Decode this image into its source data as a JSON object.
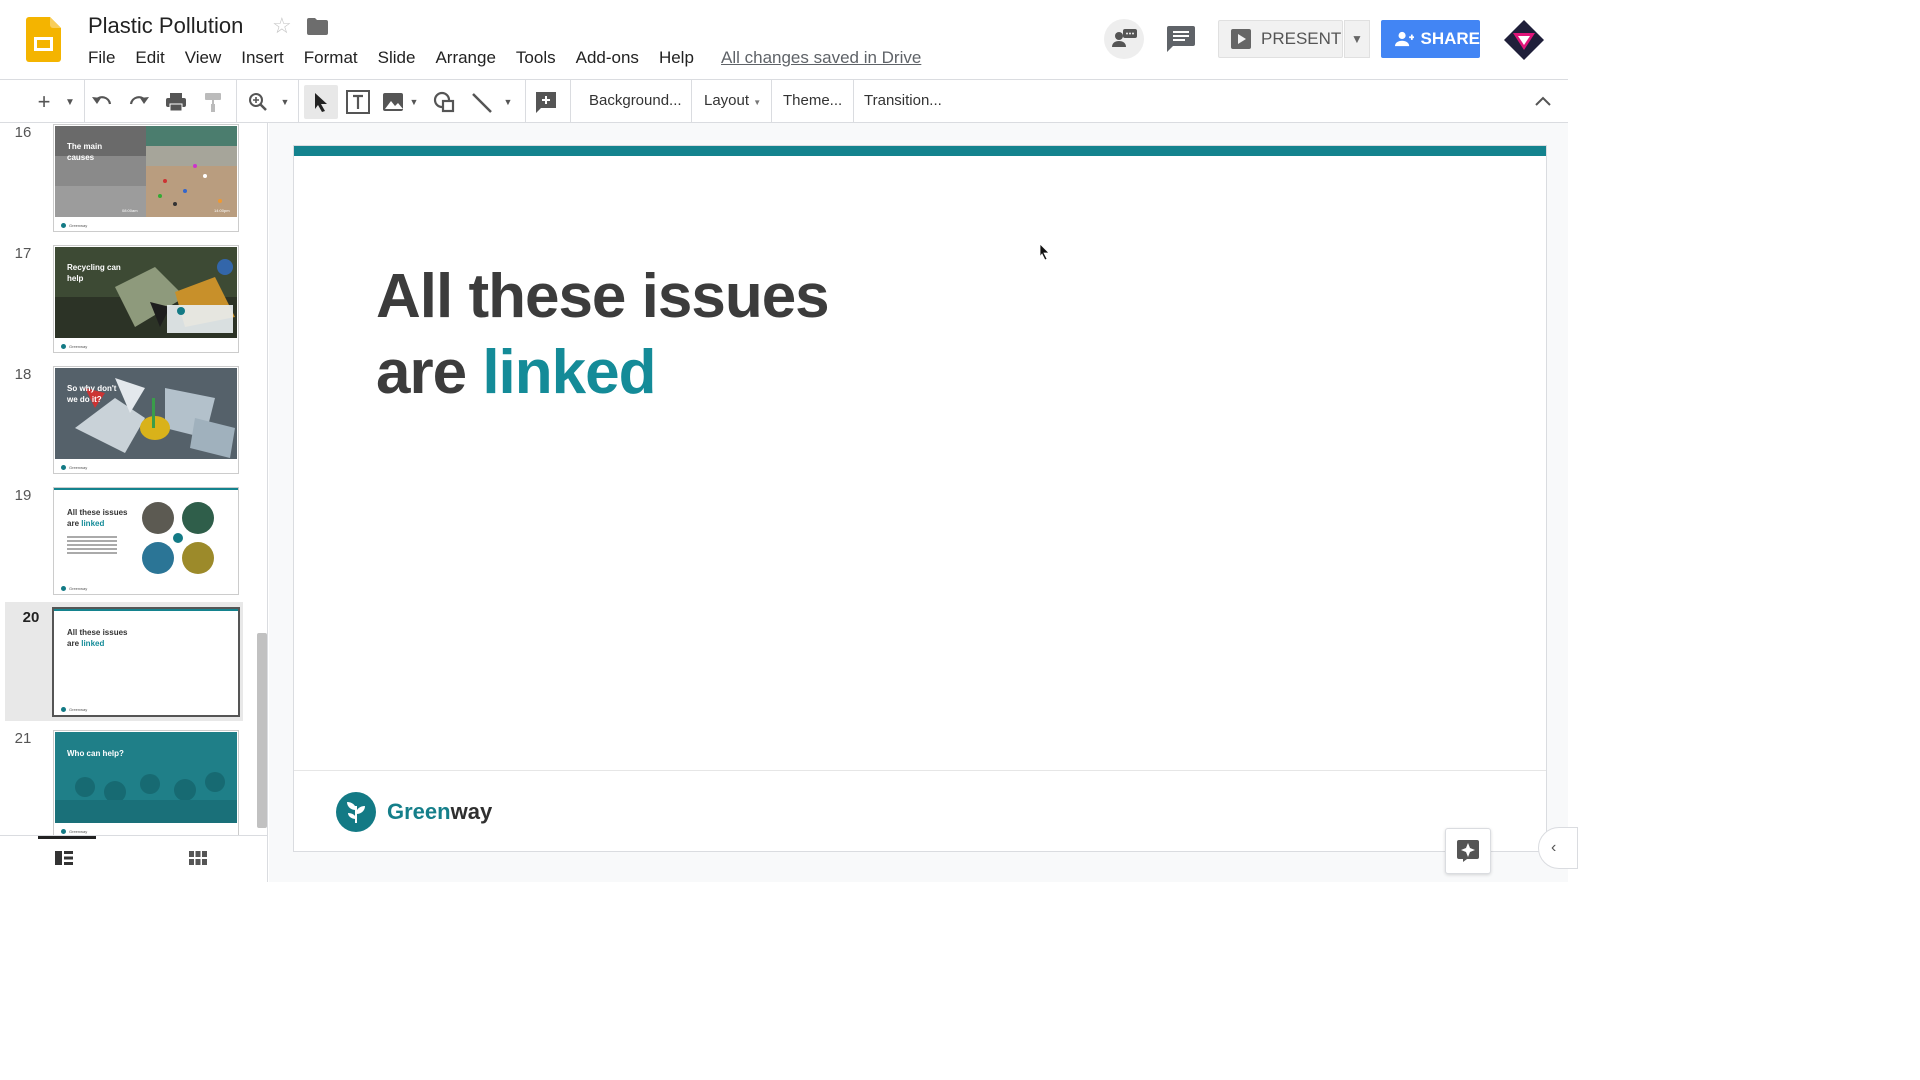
{
  "document": {
    "title": "Plastic Pollution",
    "save_status": "All changes saved in Drive"
  },
  "menu": [
    "File",
    "Edit",
    "View",
    "Insert",
    "Format",
    "Slide",
    "Arrange",
    "Tools",
    "Add-ons",
    "Help"
  ],
  "header": {
    "present_label": "PRESENT",
    "share_label": "SHARE"
  },
  "toolbar": {
    "background_label": "Background...",
    "layout_label": "Layout",
    "theme_label": "Theme...",
    "transition_label": "Transition..."
  },
  "slides": [
    {
      "num": "16",
      "title": "The main causes",
      "times": [
        "08:00am",
        "14:00pm"
      ]
    },
    {
      "num": "17",
      "title": "Recycling can help"
    },
    {
      "num": "18",
      "title": "So why don't we do it?"
    },
    {
      "num": "19",
      "title_a": "All these issues",
      "title_b": "are ",
      "title_hl": "linked"
    },
    {
      "num": "20",
      "title_a": "All these issues",
      "title_b": "are ",
      "title_hl": "linked",
      "selected": true
    },
    {
      "num": "21",
      "title": "Who can help?"
    }
  ],
  "thumb_footer": "Greenway",
  "current_slide": {
    "line1": "All these issues",
    "line2_plain": "are ",
    "line2_highlight": "linked",
    "brand_a": "Green",
    "brand_b": "way"
  },
  "colors": {
    "accent": "#148b98",
    "share_blue": "#4285f4",
    "logo_yellow": "#f4b400"
  }
}
